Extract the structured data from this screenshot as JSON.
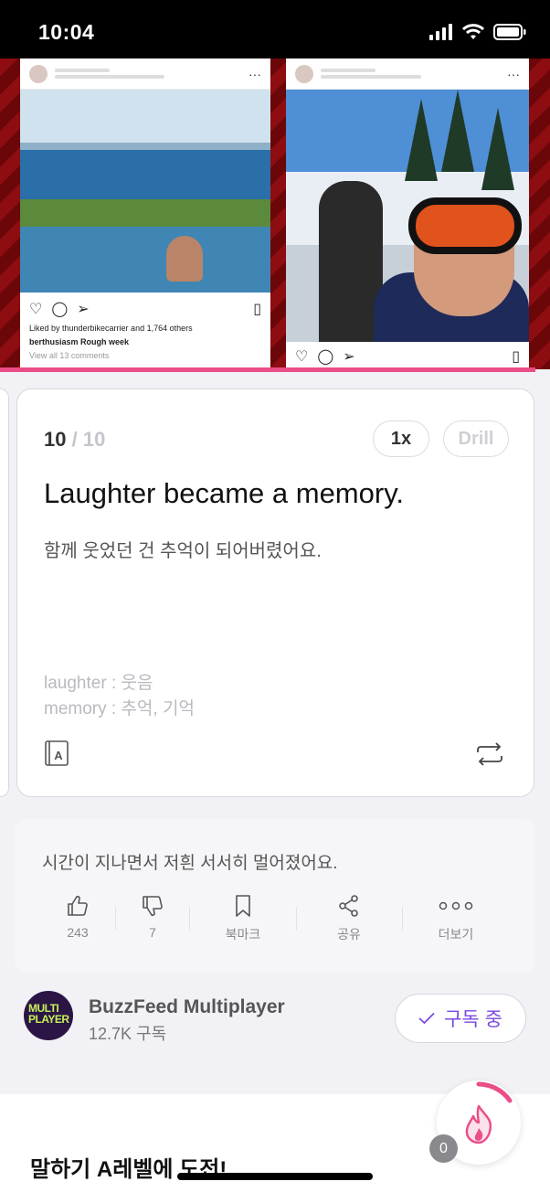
{
  "status_bar": {
    "time": "10:04"
  },
  "video": {
    "left_post": {
      "likes_text": "Liked by thunderbikecarrier and 1,764 others",
      "caption": "berthusiasm Rough week",
      "comments_link": "View all 13 comments"
    },
    "progress_color": "#ea4d87"
  },
  "card": {
    "current": "10",
    "separator": "/",
    "total": "10",
    "speed_label": "1x",
    "drill_label": "Drill",
    "english": "Laughter became a memory.",
    "korean": "함께 웃었던 건 추억이 되어버렸어요.",
    "vocab": [
      "laughter : 웃음",
      "memory : 추억, 기억"
    ]
  },
  "comment": {
    "text": "시간이 지나면서 저흰 서서히 멀어졌어요.",
    "actions": [
      {
        "label": "243",
        "icon": "thumbs-up-icon"
      },
      {
        "label": "7",
        "icon": "thumbs-down-icon"
      },
      {
        "label": "북마크",
        "icon": "bookmark-icon"
      },
      {
        "label": "공유",
        "icon": "share-icon"
      },
      {
        "label": "더보기",
        "icon": "more-icon"
      }
    ]
  },
  "channel": {
    "logo_line1": "MULTI",
    "logo_line2": "PLAYER",
    "name": "BuzzFeed Multiplayer",
    "subscribers": "12.7K 구독",
    "subscribe_label": "구독 중"
  },
  "bottom": {
    "title": "말하기 A레벨에 도전!",
    "badge_count": "0"
  },
  "colors": {
    "accent": "#7a4ae0",
    "fire": "#ea4d87"
  }
}
